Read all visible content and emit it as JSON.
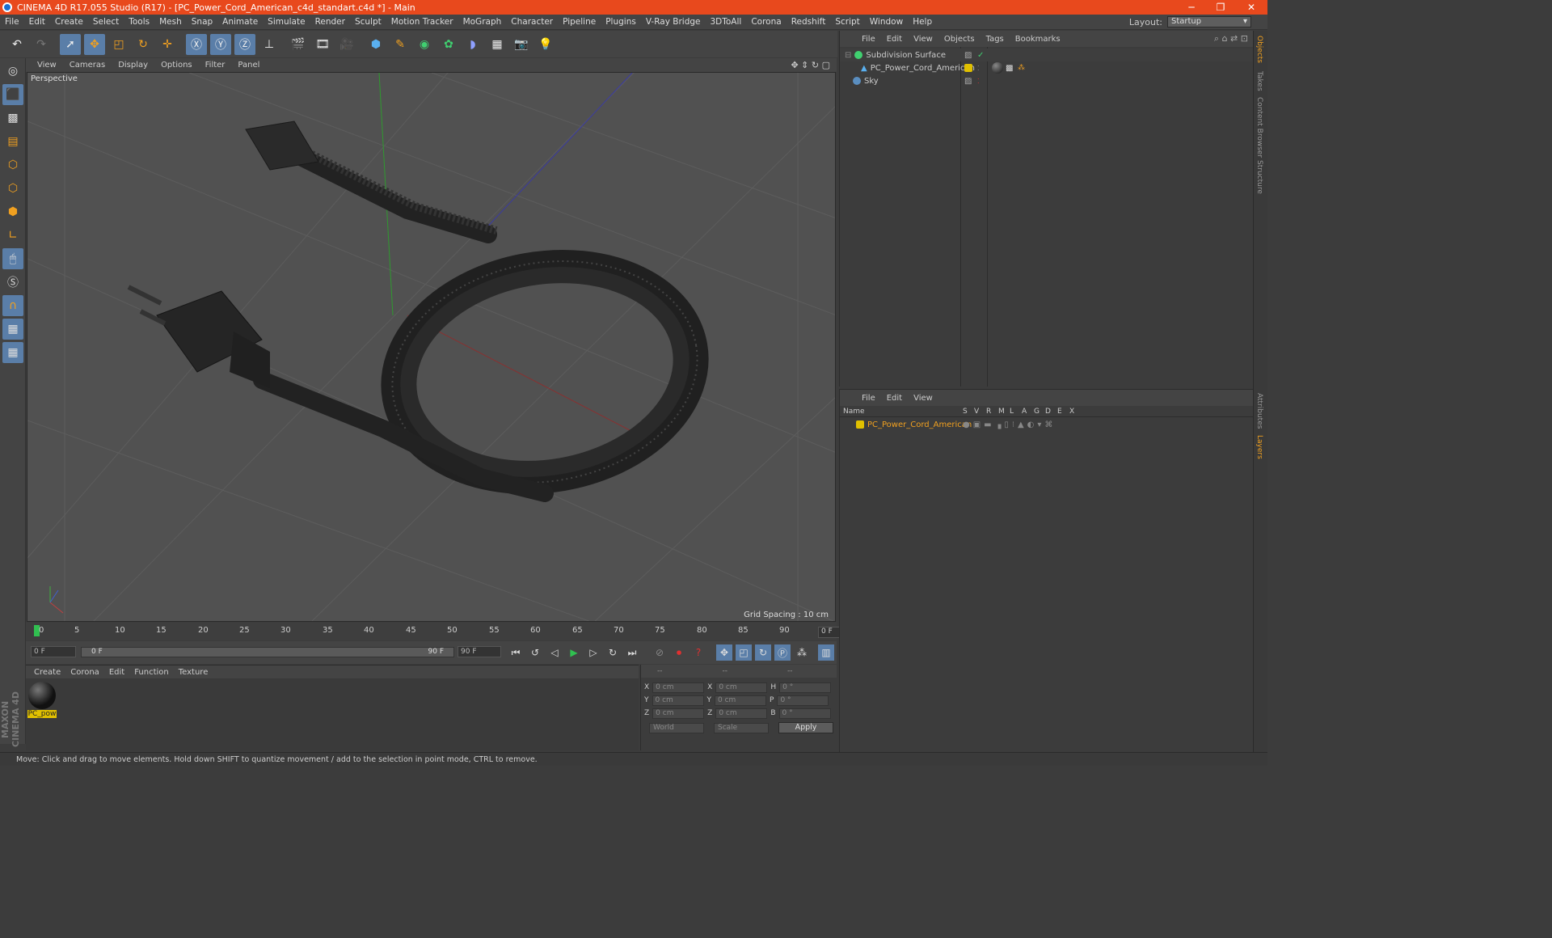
{
  "window": {
    "title": "CINEMA 4D R17.055 Studio (R17) - [PC_Power_Cord_American_c4d_standart.c4d *] - Main",
    "min": "─",
    "max": "❐",
    "close": "✕"
  },
  "menu": [
    "File",
    "Edit",
    "Create",
    "Select",
    "Tools",
    "Mesh",
    "Snap",
    "Animate",
    "Simulate",
    "Render",
    "Sculpt",
    "Motion Tracker",
    "MoGraph",
    "Character",
    "Pipeline",
    "Plugins",
    "V-Ray Bridge",
    "3DToAll",
    "Corona",
    "Redshift",
    "Script",
    "Window",
    "Help"
  ],
  "layout": {
    "label": "Layout:",
    "value": "Startup"
  },
  "viewport": {
    "menu": [
      "View",
      "Cameras",
      "Display",
      "Options",
      "Filter",
      "Panel"
    ],
    "label": "Perspective",
    "grid": "Grid Spacing : 10 cm"
  },
  "timeline": {
    "ticks": [
      "0",
      "5",
      "10",
      "15",
      "20",
      "25",
      "30",
      "35",
      "40",
      "45",
      "50",
      "55",
      "60",
      "65",
      "70",
      "75",
      "80",
      "85",
      "90"
    ],
    "current": "0 F"
  },
  "transport": {
    "start": "0 F",
    "slider_start": "0 F",
    "slider_end": "90 F",
    "end": "90 F"
  },
  "materials": {
    "menu": [
      "Create",
      "Corona",
      "Edit",
      "Function",
      "Texture"
    ],
    "item": "PC_pow"
  },
  "coords": {
    "headers": [
      "--",
      "--",
      "--"
    ],
    "rows": [
      {
        "a": "X",
        "v1": "0 cm",
        "b": "X",
        "v2": "0 cm",
        "c": "H",
        "v3": "0 °"
      },
      {
        "a": "Y",
        "v1": "0 cm",
        "b": "Y",
        "v2": "0 cm",
        "c": "P",
        "v3": "0 °"
      },
      {
        "a": "Z",
        "v1": "0 cm",
        "b": "Z",
        "v2": "0 cm",
        "c": "B",
        "v3": "0 °"
      }
    ],
    "world": "World",
    "scale": "Scale",
    "apply": "Apply"
  },
  "objects": {
    "menu": [
      "File",
      "Edit",
      "View",
      "Objects",
      "Tags",
      "Bookmarks"
    ],
    "items": [
      "Subdivision Surface",
      "PC_Power_Cord_American",
      "Sky"
    ]
  },
  "layers": {
    "menu": [
      "File",
      "Edit",
      "View"
    ],
    "col_name": "Name",
    "cols": [
      "S",
      "V",
      "R",
      "M",
      "L",
      "A",
      "G",
      "D",
      "E",
      "X"
    ],
    "item": "PC_Power_Cord_American"
  },
  "side_tabs": [
    "Objects",
    "Takes",
    "Content Browser",
    "Structure",
    "Attributes",
    "Layers"
  ],
  "status": "Move: Click and drag to move elements. Hold down SHIFT to quantize movement / add to the selection in point mode, CTRL to remove.",
  "colors": {
    "title": "#e8491d",
    "accent": "#5a7ea8",
    "layer": "#e0c000"
  }
}
